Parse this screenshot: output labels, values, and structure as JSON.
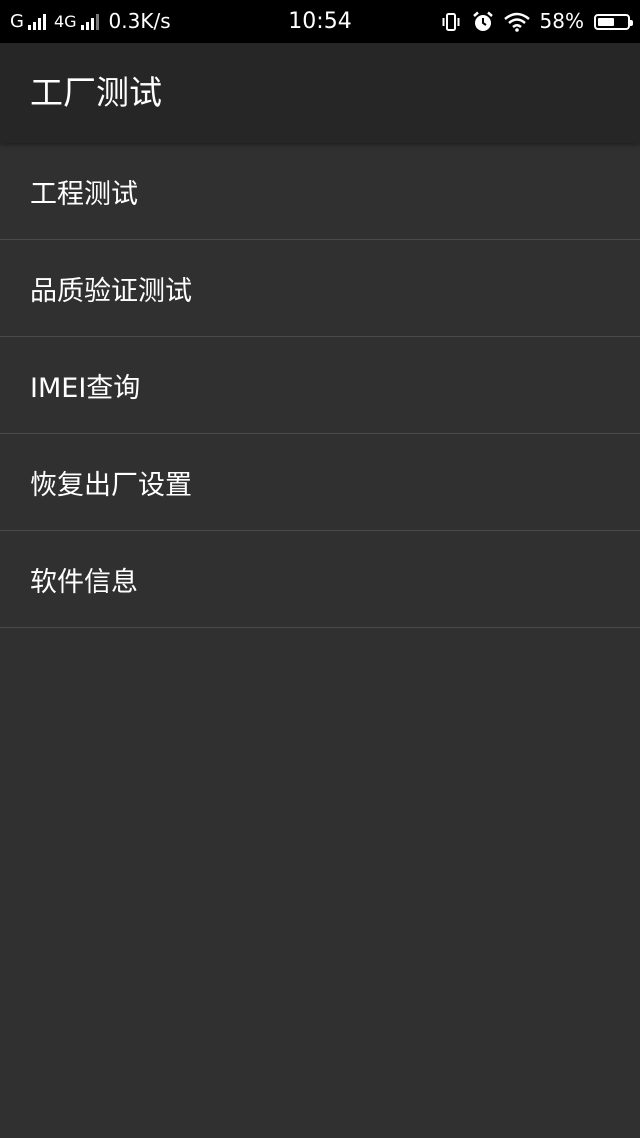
{
  "status_bar": {
    "carrier1": "G",
    "carrier2": "4G",
    "net_speed": "0.3K/s",
    "time": "10:54",
    "battery_percent_label": "58%",
    "battery_level": 0.58,
    "icons": [
      "signal-icon",
      "signal-4g-icon",
      "vibrate-icon",
      "alarm-icon",
      "wifi-icon",
      "battery-icon"
    ]
  },
  "app_bar": {
    "title": "工厂测试"
  },
  "menu": {
    "items": [
      {
        "label": "工程测试"
      },
      {
        "label": "品质验证测试"
      },
      {
        "label": "IMEI查询"
      },
      {
        "label": "恢复出厂设置"
      },
      {
        "label": "软件信息"
      }
    ]
  },
  "colors": {
    "background": "#303030",
    "app_bar": "#262626",
    "status_bar": "#000000",
    "divider": "#4a4a4a",
    "text": "#ffffff"
  }
}
